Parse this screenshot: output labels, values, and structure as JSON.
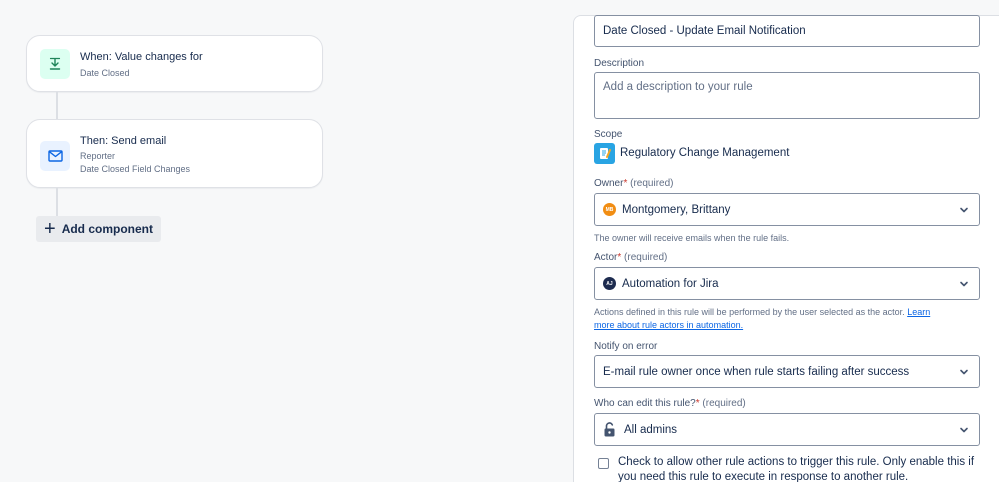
{
  "canvas": {
    "trigger": {
      "title": "When: Value changes for",
      "subtitle": "Date Closed",
      "icon": "value-change-icon"
    },
    "action": {
      "title": "Then: Send email",
      "line1": "Reporter",
      "line2": "Date Closed Field Changes",
      "icon": "mail-icon"
    },
    "add_component_label": "Add component"
  },
  "details": {
    "name_value": "Date Closed - Update Email Notification",
    "description_label": "Description",
    "description_placeholder": "Add a description to your rule",
    "scope_label": "Scope",
    "scope_value": "Regulatory Change Management",
    "owner_label": "Owner",
    "owner_required_mark": "*",
    "owner_required_text": "(required)",
    "owner_initials": "MB",
    "owner_value": "Montgomery, Brittany",
    "owner_helper": "The owner will receive emails when the rule fails.",
    "actor_label": "Actor",
    "actor_required_mark": "*",
    "actor_required_text": "(required)",
    "actor_initials": "AJ",
    "actor_value": "Automation for Jira",
    "actor_helper": "Actions defined in this rule will be performed by the user selected as the actor.",
    "actor_helper_link_1": "Learn",
    "actor_helper_link_2": "more about rule actors in automation.",
    "notify_label": "Notify on error",
    "notify_value": "E-mail rule owner once when rule starts failing after success",
    "edit_label": "Who can edit this rule?",
    "edit_required_mark": "*",
    "edit_required_text": "(required)",
    "edit_value": "All admins",
    "check_text": "Check to allow other rule actions to trigger this rule. Only enable this if you need this rule to execute in response to another rule."
  },
  "colors": {
    "accent": "#0c66e4",
    "required": "#c9372c",
    "owner_avatar": "#f18d13",
    "actor_avatar": "#1d2b4f"
  }
}
